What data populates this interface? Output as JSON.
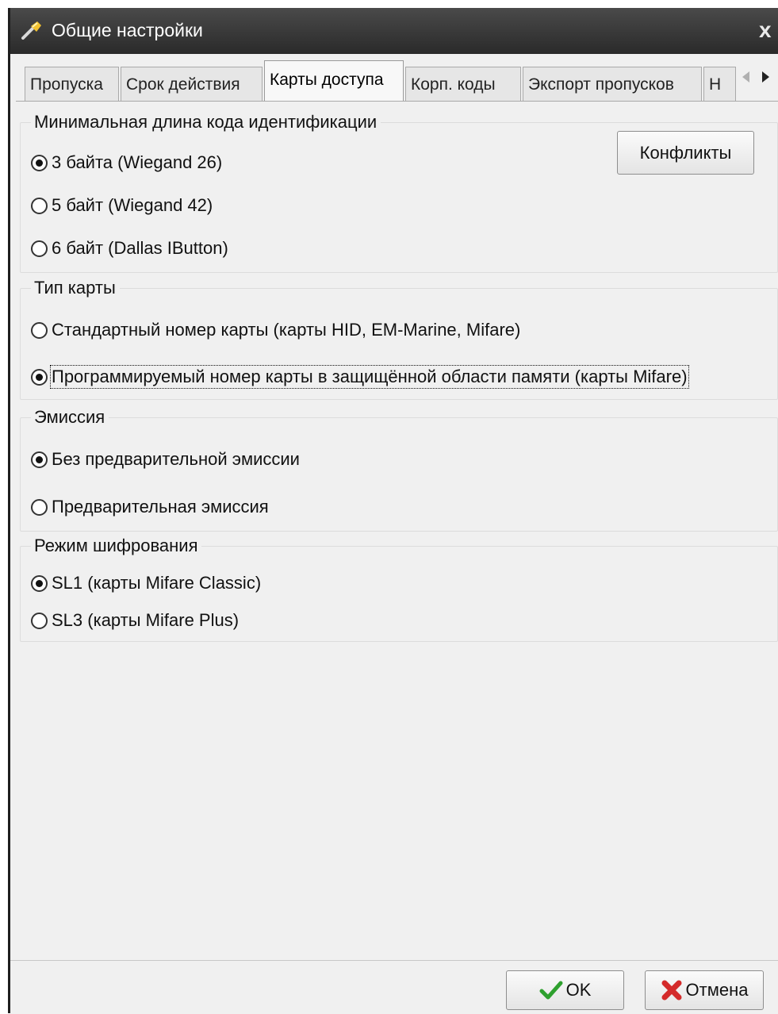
{
  "window": {
    "title": "Общие настройки",
    "close_glyph": "x",
    "title_icon": "wrench-icon"
  },
  "tabs": [
    {
      "label": "Пропуска",
      "active": false
    },
    {
      "label": "Срок действия",
      "active": false
    },
    {
      "label": "Карты доступа",
      "active": true
    },
    {
      "label": "Корп. коды",
      "active": false
    },
    {
      "label": "Экспорт пропусков",
      "active": false
    },
    {
      "label": "Н",
      "active": false
    }
  ],
  "code_length": {
    "title": "Минимальная длина кода идентификации",
    "options": [
      {
        "label": "3 байта (Wiegand 26)",
        "checked": true
      },
      {
        "label": "5 байт (Wiegand 42)",
        "checked": false
      },
      {
        "label": "6 байт (Dallas IButton)",
        "checked": false
      }
    ],
    "conflicts_button": "Конфликты"
  },
  "card_type": {
    "title": "Тип карты",
    "options": [
      {
        "label": "Стандартный номер карты (карты HID, EM-Marine, Mifare)",
        "checked": false
      },
      {
        "label": "Программируемый номер карты в защищённой области памяти (карты Mifare)",
        "checked": true
      }
    ]
  },
  "emission": {
    "title": "Эмиссия",
    "options": [
      {
        "label": "Без предварительной эмиссии",
        "checked": true
      },
      {
        "label": "Предварительная эмиссия",
        "checked": false
      }
    ]
  },
  "encryption": {
    "title": "Режим шифрования",
    "options": [
      {
        "label": "SL1 (карты Mifare Classic)",
        "checked": true
      },
      {
        "label": "SL3 (карты Mifare Plus)",
        "checked": false
      }
    ]
  },
  "footer": {
    "ok_label": "OK",
    "cancel_label": "Отмена",
    "ok_icon": "checkmark-icon",
    "cancel_icon": "red-x-icon",
    "ok_icon_color": "#2ea02e",
    "cancel_icon_color": "#d42a2a"
  }
}
